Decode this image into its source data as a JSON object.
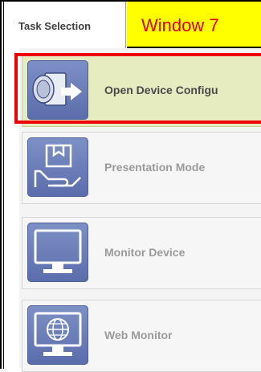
{
  "tab": {
    "label": "Task Selection"
  },
  "window_label": "Window 7",
  "tasks": [
    {
      "label": "Open Device Configu",
      "icon": "device-configuration-icon",
      "selected": true
    },
    {
      "label": "Presentation Mode",
      "icon": "presentation-hand-icon",
      "selected": false
    },
    {
      "label": "Monitor Device",
      "icon": "monitor-icon",
      "selected": false
    },
    {
      "label": "Web Monitor",
      "icon": "web-monitor-globe-icon",
      "selected": false
    }
  ],
  "colors": {
    "highlight": "#ee0000",
    "window_label_bg": "#ffff00",
    "window_label_text": "#e00000",
    "selected_bg": "#e6ecc0",
    "icon_bg": "#6a7db8"
  }
}
